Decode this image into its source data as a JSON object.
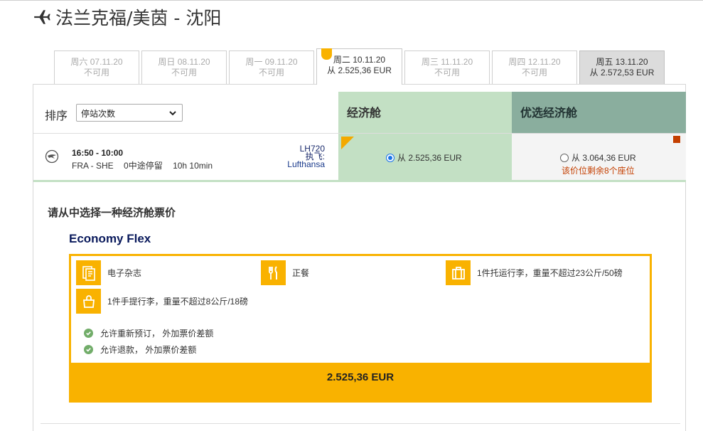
{
  "header": {
    "route": "法兰克福/美茵 - 沈阳"
  },
  "tabs": [
    {
      "day": "周六 07.11.20",
      "status": "不可用",
      "state": "unavailable"
    },
    {
      "day": "周日 08.11.20",
      "status": "不可用",
      "state": "unavailable"
    },
    {
      "day": "周一 09.11.20",
      "status": "不可用",
      "state": "unavailable"
    },
    {
      "day": "周二 10.11.20",
      "status": "从 2.525,36 EUR",
      "state": "selected"
    },
    {
      "day": "周三 11.11.20",
      "status": "不可用",
      "state": "unavailable"
    },
    {
      "day": "周四 12.11.20",
      "status": "不可用",
      "state": "unavailable"
    },
    {
      "day": "周五 13.11.20",
      "status": "从 2.572,53 EUR",
      "state": "available"
    }
  ],
  "sort": {
    "label": "排序",
    "selected": "停站次数"
  },
  "cabins": {
    "economy": "经济舱",
    "premium": "优选经济舱"
  },
  "flight": {
    "time": "16:50 - 10:00",
    "route": "FRA - SHE",
    "stops": "0中途停留",
    "duration": "10h 10min",
    "number": "LH720",
    "operated_label": "执飞:",
    "carrier": "Lufthansa",
    "economy_price": "从 2.525,36 EUR",
    "premium_price": "从 3.064,36 EUR",
    "premium_seats": "该价位剩余8个座位"
  },
  "fare": {
    "choose_title": "请从中选择一种经济舱票价",
    "name": "Economy Flex",
    "features": {
      "magazine": "电子杂志",
      "meal": "正餐",
      "checked_bag": "1件托运行李，重量不超过23公斤/50磅",
      "hand_bag": "1件手提行李，重量不超过8公斤/18磅"
    },
    "rebook": "允许重新预订， 外加票价差额",
    "refund": "允许退款， 外加票价差额",
    "price": "2.525,36 EUR"
  },
  "colors": {
    "accent": "#f9b200",
    "economy": "#c3e0c4",
    "premium": "#8aae9e",
    "warning": "#c43f00"
  }
}
